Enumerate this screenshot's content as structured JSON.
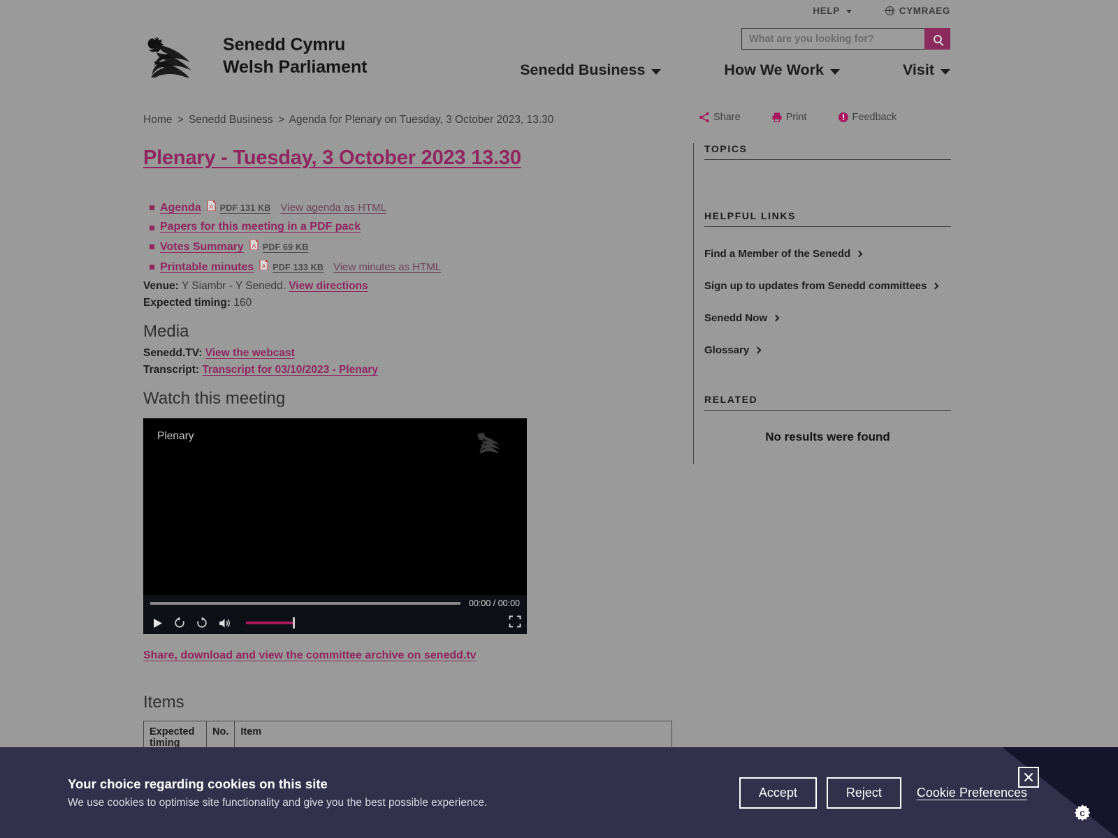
{
  "utility": {
    "help": "HELP",
    "language": "CYMRAEG"
  },
  "search": {
    "placeholder": "What are you looking for?",
    "value": ""
  },
  "brand": {
    "line1": "Senedd Cymru",
    "line2": "Welsh Parliament"
  },
  "nav": {
    "items": [
      {
        "label": "Senedd Business"
      },
      {
        "label": "How We Work"
      },
      {
        "label": "Visit"
      }
    ]
  },
  "breadcrumb": {
    "home": "Home",
    "section": "Senedd Business",
    "current": "Agenda for Plenary on Tuesday, 3 October 2023, 13.30",
    "separator": ">"
  },
  "page_actions": {
    "share": "Share",
    "print": "Print",
    "feedback": "Feedback"
  },
  "main": {
    "title": "Plenary - Tuesday, 3 October 2023 13.30",
    "documents": [
      {
        "label": "Agenda",
        "size": "PDF 131 KB",
        "html_link": "View agenda as HTML",
        "has_pdf_icon": true
      },
      {
        "label": "Papers for this meeting in a PDF pack",
        "size": "",
        "html_link": "",
        "has_pdf_icon": false
      },
      {
        "label": "Votes Summary",
        "size": "PDF 69 KB",
        "html_link": "",
        "has_pdf_icon": true
      },
      {
        "label": "Printable minutes",
        "size": "PDF 133 KB",
        "html_link": "View minutes as HTML",
        "has_pdf_icon": true
      }
    ],
    "venue_label": "Venue:",
    "venue_value": "Y Siambr - Y Senedd.",
    "venue_link": "View directions",
    "timing_label": "Expected timing:",
    "timing_value": "160",
    "media_heading": "Media",
    "seneddtv_label": "Senedd.TV:",
    "seneddtv_link": "View the webcast",
    "transcript_label": "Transcript:",
    "transcript_link": "Transcript for 03/10/2023 - Plenary",
    "watch_heading": "Watch this meeting",
    "archive_link": "Share, download and view the committee archive on senedd.tv",
    "items_heading": "Items"
  },
  "video": {
    "label": "Plenary",
    "current_time": "00:00",
    "duration": "00:00",
    "time_display": "00:00 / 00:00",
    "progress_percent": 0,
    "volume_percent": 85
  },
  "items_table": {
    "headers": [
      "Expected timing",
      "No.",
      "Item"
    ],
    "rows": [
      [
        "",
        "",
        ""
      ]
    ]
  },
  "sidebar": {
    "topics_heading": "TOPICS",
    "topics": [],
    "helpful_heading": "HELPFUL LINKS",
    "helpful_links": [
      {
        "label": "Find a Member of the Senedd"
      },
      {
        "label": "Sign up to updates from Senedd committees"
      },
      {
        "label": "Senedd Now"
      },
      {
        "label": "Glossary"
      }
    ],
    "related_heading": "RELATED",
    "related_empty": "No results were found"
  },
  "cookie_banner": {
    "title": "Your choice regarding cookies on this site",
    "subtitle": "We use cookies to optimise site functionality and give you the best possible experience.",
    "accept": "Accept",
    "reject": "Reject",
    "preferences": "Cookie Preferences"
  },
  "colors": {
    "accent_magenta": "#8e2760",
    "search_button": "#8b2a5c",
    "banner_bg": "#31314b",
    "banner_corner": "#14142b",
    "page_dim": "#9a9a9a"
  }
}
